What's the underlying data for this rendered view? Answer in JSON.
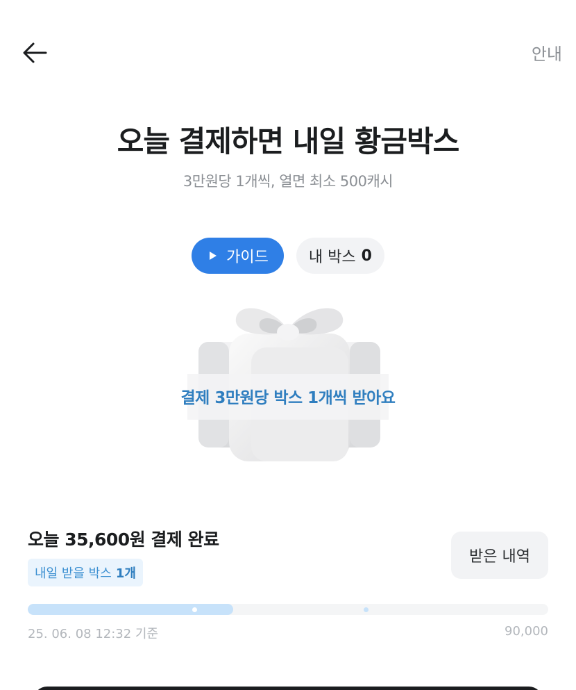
{
  "header": {
    "back_icon": "arrow-left-icon",
    "info_label": "안내"
  },
  "hero": {
    "title": "오늘 결제하면 내일 황금박스",
    "subtitle": "3만원당 1개씩, 열면 최소 500캐시"
  },
  "chips": {
    "guide_icon": "play-icon",
    "guide_label": "가이드",
    "mybox_label": "내 박스",
    "mybox_count": "0"
  },
  "gift": {
    "icon": "gift-box-icon",
    "caption": "결제 3만원당 박스 1개씩 받아요"
  },
  "summary": {
    "paid_text": "오늘 35,600원 결제 완료",
    "tomorrow_label": "내일 받을 박스",
    "tomorrow_count": "1개",
    "history_button": "받은 내역"
  },
  "progress": {
    "current_amount": 35600,
    "max_amount": 90000,
    "fill_fraction": 0.395,
    "date_text": "25. 06. 08 12:32 기준",
    "max_label": "90,000",
    "track_color": "#f4f5f6",
    "fill_color": "#c7e2fa"
  },
  "colors": {
    "accent": "#2f7fe6",
    "caption_blue": "#2f7ebf",
    "muted": "#8b8f94"
  }
}
